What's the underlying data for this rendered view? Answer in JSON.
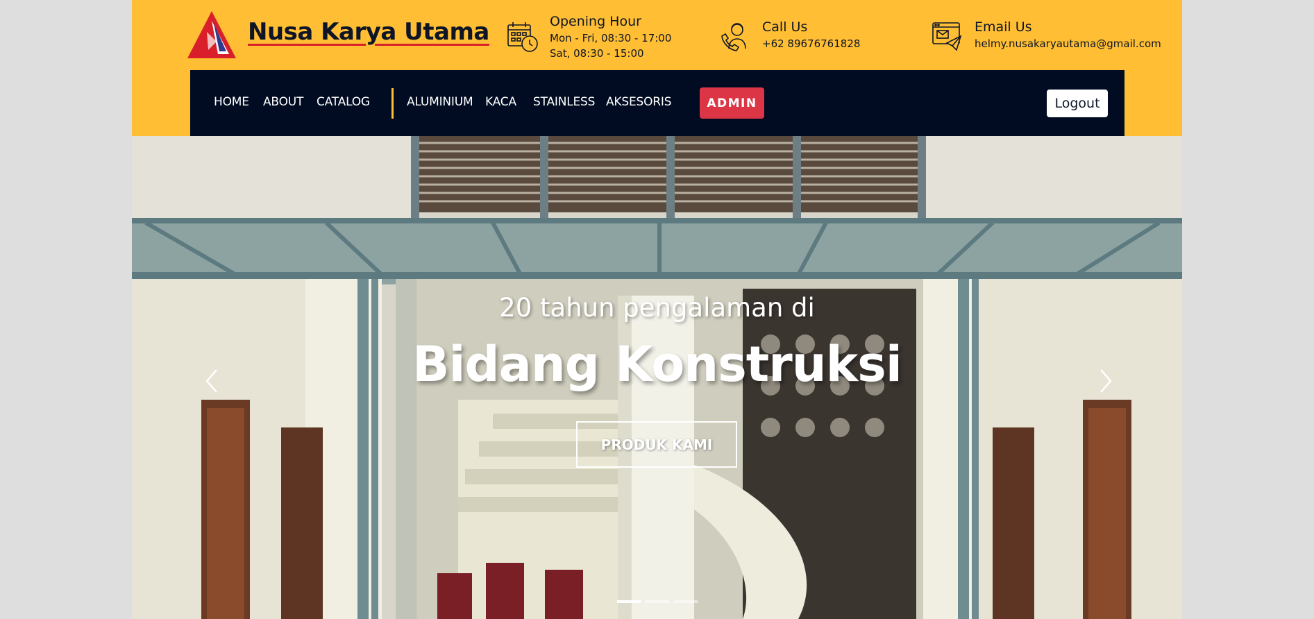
{
  "brand": {
    "name": "Nusa Karya Utama"
  },
  "contact": {
    "opening": {
      "title": "Opening Hour",
      "line1": "Mon - Fri, 08:30 - 17:00",
      "line2": "Sat, 08:30 - 15:00",
      "icon": "calendar-clock-icon"
    },
    "call": {
      "title": "Call Us",
      "value": "+62 89676761828",
      "icon": "phone-support-icon"
    },
    "email": {
      "title": "Email Us",
      "value": "helmy.nusakaryautama@gmail.com",
      "icon": "email-icon"
    }
  },
  "nav": {
    "items": [
      {
        "label": "HOME"
      },
      {
        "label": "ABOUT"
      },
      {
        "label": "CATALOG"
      },
      {
        "label": "ALUMINIUM"
      },
      {
        "label": "KACA"
      },
      {
        "label": "STAINLESS"
      },
      {
        "label": "AKSESORIS"
      }
    ],
    "admin_label": "ADMIN",
    "logout_label": "Logout"
  },
  "hero": {
    "subtitle": "20 tahun pengalaman di",
    "title": "Bidang Konstruksi",
    "button_label": "PRODUK KAMI",
    "slides": 3,
    "active_slide": 1
  },
  "colors": {
    "accent_yellow": "#ffbe33",
    "nav_dark": "#010c22",
    "admin_red": "#dc3545",
    "brand_underline": "#d9202a"
  }
}
